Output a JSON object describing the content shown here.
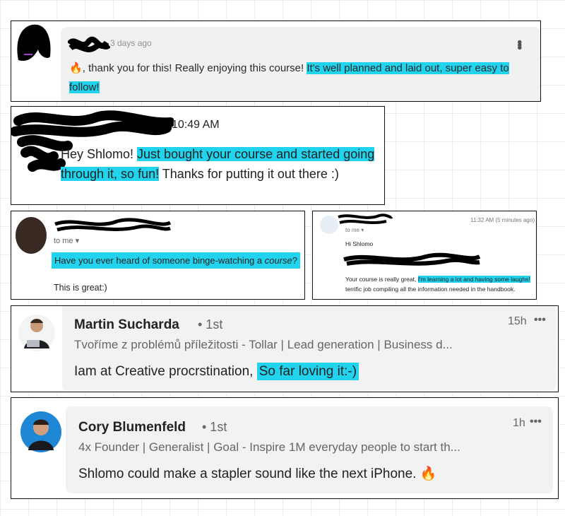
{
  "comment1": {
    "time": "3 days ago",
    "emoji": "🔥",
    "text_plain": ", thank you for this!  Really enjoying this course! ",
    "text_highlight": "It's well planned and laid out, super easy to follow!",
    "menu_icon": "more-vert-icon"
  },
  "comment2": {
    "time": "10:49 AM",
    "text_start": "Hey Shlomo! ",
    "text_highlight": "Just bought your course and started going through it, so fun!",
    "text_end": " Thanks for putting it out there :)"
  },
  "email1": {
    "to_me": "to me",
    "question_start": "Have you ever heard of someone binge-watching a ",
    "question_emph": "course",
    "question_end": "?",
    "body": "This is great:)"
  },
  "email2": {
    "time": "11:32 AM (5 minutes ago)",
    "to_me": "to me",
    "greeting": "Hi Shlomo",
    "body_start": "Your course is really great, ",
    "body_highlight": "I'm learning a lot and having some laughs!",
    "body_end": " terrific job compiling all the information needed in the handbook."
  },
  "linkedin1": {
    "name": "Martin Sucharda",
    "degree": "• 1st",
    "headline": "Tvoříme z problémů příležitosti - Tollar | Lead generation | Business d...",
    "time": "15h",
    "more": "•••",
    "msg_plain": "Iam at Creative procrstination, ",
    "msg_highlight": "So far loving it:-)"
  },
  "linkedin2": {
    "name": "Cory Blumenfeld",
    "degree": "• 1st",
    "headline": "4x Founder | Generalist | Goal - Inspire 1M everyday people to start th...",
    "time": "1h",
    "more": "•••",
    "msg": "Shlomo could make a stapler sound like the next iPhone. ",
    "emoji": "🔥"
  },
  "colors": {
    "highlight": "#22d3ee",
    "bubble": "#f2f2f2"
  }
}
